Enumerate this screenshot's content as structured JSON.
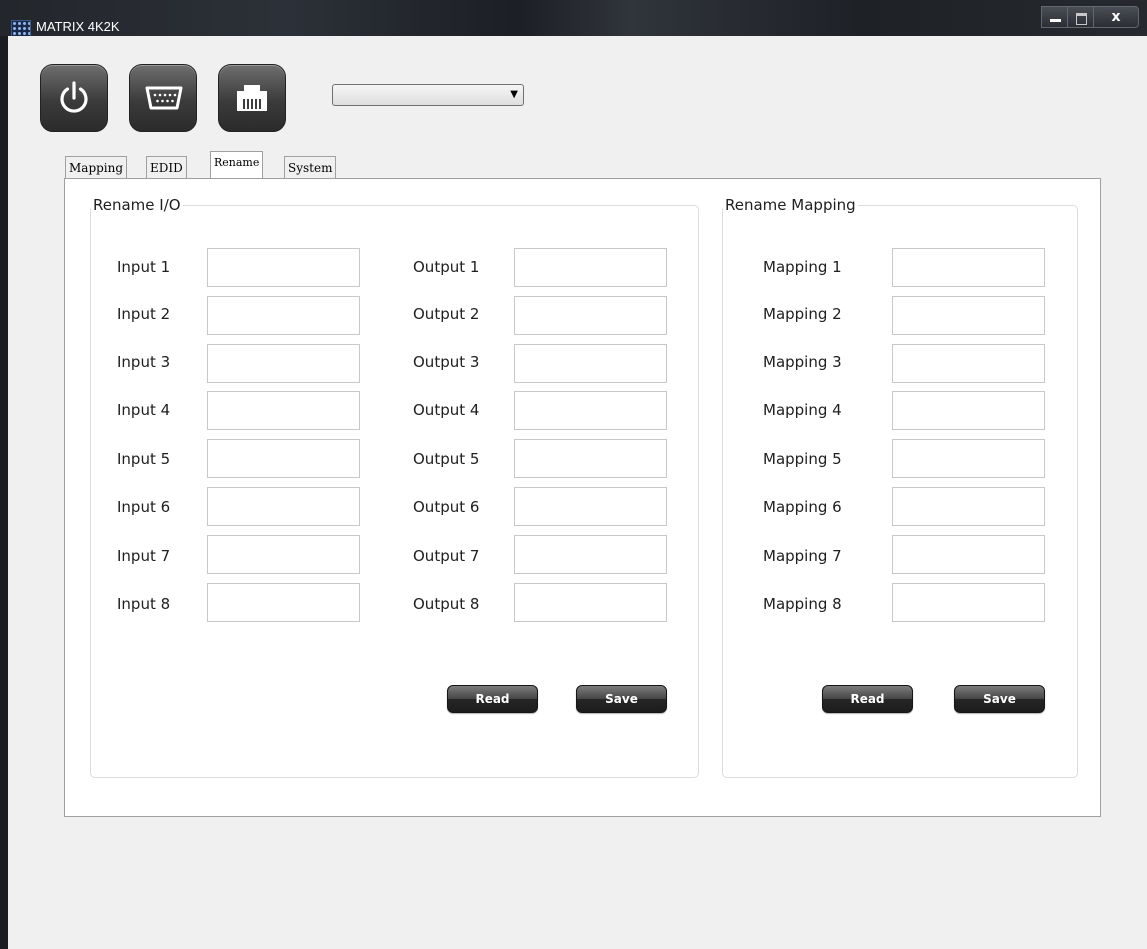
{
  "window": {
    "title": "MATRIX 4K2K",
    "close_glyph": "x"
  },
  "toolbar": {
    "icons": [
      "power-icon",
      "serial-port-icon",
      "ethernet-port-icon"
    ],
    "combo_value": ""
  },
  "tabs": [
    {
      "label": "Mapping",
      "active": false
    },
    {
      "label": "EDID",
      "active": false
    },
    {
      "label": "Rename",
      "active": true
    },
    {
      "label": "System",
      "active": false
    }
  ],
  "rename_io": {
    "title": "Rename I/O",
    "inputs": [
      {
        "label": "Input 1",
        "value": ""
      },
      {
        "label": "Input 2",
        "value": ""
      },
      {
        "label": "Input 3",
        "value": ""
      },
      {
        "label": "Input 4",
        "value": ""
      },
      {
        "label": "Input 5",
        "value": ""
      },
      {
        "label": "Input 6",
        "value": ""
      },
      {
        "label": "Input 7",
        "value": ""
      },
      {
        "label": "Input 8",
        "value": ""
      }
    ],
    "outputs": [
      {
        "label": "Output 1",
        "value": ""
      },
      {
        "label": "Output 2",
        "value": ""
      },
      {
        "label": "Output 3",
        "value": ""
      },
      {
        "label": "Output 4",
        "value": ""
      },
      {
        "label": "Output 5",
        "value": ""
      },
      {
        "label": "Output 6",
        "value": ""
      },
      {
        "label": "Output 7",
        "value": ""
      },
      {
        "label": "Output 8",
        "value": ""
      }
    ],
    "read_label": "Read",
    "save_label": "Save"
  },
  "rename_mapping": {
    "title": "Rename Mapping",
    "mappings": [
      {
        "label": "Mapping 1",
        "value": ""
      },
      {
        "label": "Mapping 2",
        "value": ""
      },
      {
        "label": "Mapping 3",
        "value": ""
      },
      {
        "label": "Mapping 4",
        "value": ""
      },
      {
        "label": "Mapping 5",
        "value": ""
      },
      {
        "label": "Mapping 6",
        "value": ""
      },
      {
        "label": "Mapping 7",
        "value": ""
      },
      {
        "label": "Mapping 8",
        "value": ""
      }
    ],
    "read_label": "Read",
    "save_label": "Save"
  }
}
